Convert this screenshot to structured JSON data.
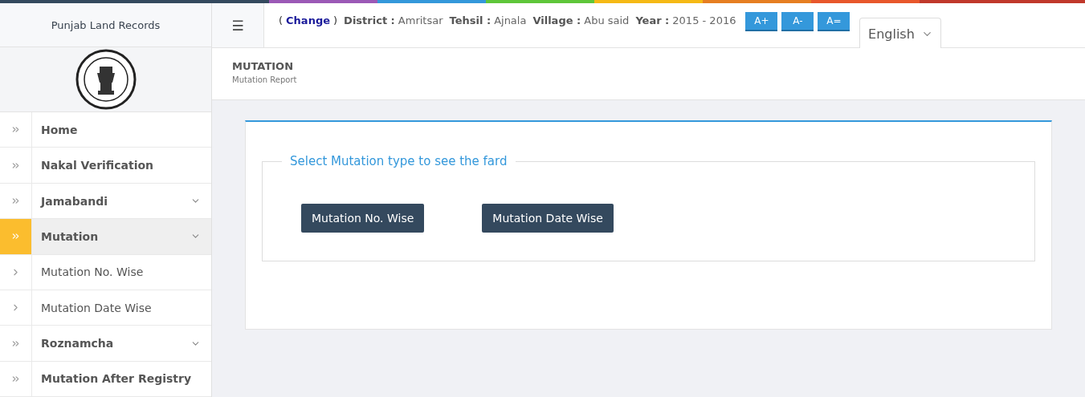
{
  "sidebar": {
    "title": "Punjab Land Records",
    "items": [
      {
        "label": "Home",
        "kind": "section",
        "selected": false,
        "expandable": false
      },
      {
        "label": "Nakal Verification",
        "kind": "section",
        "selected": false,
        "expandable": false
      },
      {
        "label": "Jamabandi",
        "kind": "section",
        "selected": false,
        "expandable": true
      },
      {
        "label": "Mutation",
        "kind": "section",
        "selected": true,
        "expandable": true
      },
      {
        "label": "Mutation No. Wise",
        "kind": "sub",
        "selected": false,
        "expandable": false
      },
      {
        "label": "Mutation Date Wise",
        "kind": "sub",
        "selected": false,
        "expandable": false
      },
      {
        "label": "Roznamcha",
        "kind": "section",
        "selected": false,
        "expandable": true
      },
      {
        "label": "Mutation After Registry",
        "kind": "section",
        "selected": false,
        "expandable": false
      }
    ]
  },
  "header": {
    "menu_glyph": "☰",
    "change_open": "(",
    "change_link": "Change",
    "change_close": ")",
    "fields": [
      {
        "label": "District :",
        "value": "Amritsar"
      },
      {
        "label": "Tehsil :",
        "value": "Ajnala"
      },
      {
        "label": "Village :",
        "value": "Abu said"
      },
      {
        "label": "Year :",
        "value": "2015 - 2016"
      }
    ],
    "font_buttons": [
      "A+",
      "A-",
      "A="
    ],
    "language": "English"
  },
  "page": {
    "title": "MUTATION",
    "subtitle": "Mutation Report"
  },
  "panel": {
    "legend": "Select Mutation type to see the fard",
    "buttons": [
      "Mutation No. Wise",
      "Mutation Date Wise"
    ]
  }
}
